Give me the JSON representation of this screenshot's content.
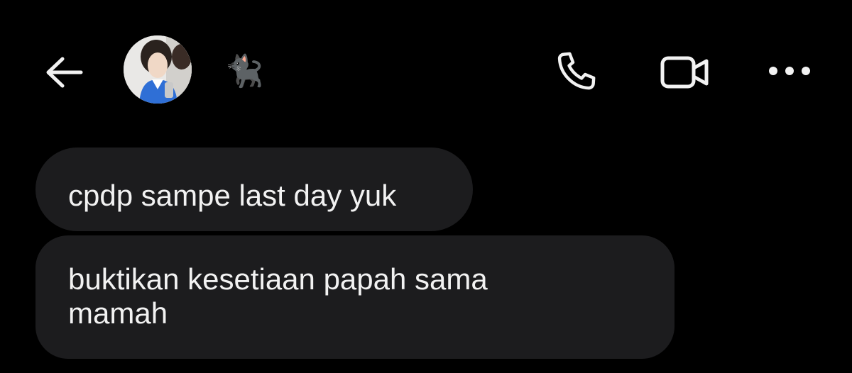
{
  "header": {
    "back_icon": "arrow-left-icon",
    "avatar_icon": "profile-photo",
    "contact_name": "🐈‍⬛",
    "call_icon": "phone-icon",
    "video_icon": "video-camera-icon",
    "more_icon": "more-horizontal-icon"
  },
  "messages": [
    {
      "text": "cpdp sampe last day yuk"
    },
    {
      "text": "buktikan kesetiaan papah sama\nmamah"
    }
  ],
  "colors": {
    "background": "#000000",
    "bubble": "#1c1c1e",
    "text": "#f2f2f2"
  }
}
